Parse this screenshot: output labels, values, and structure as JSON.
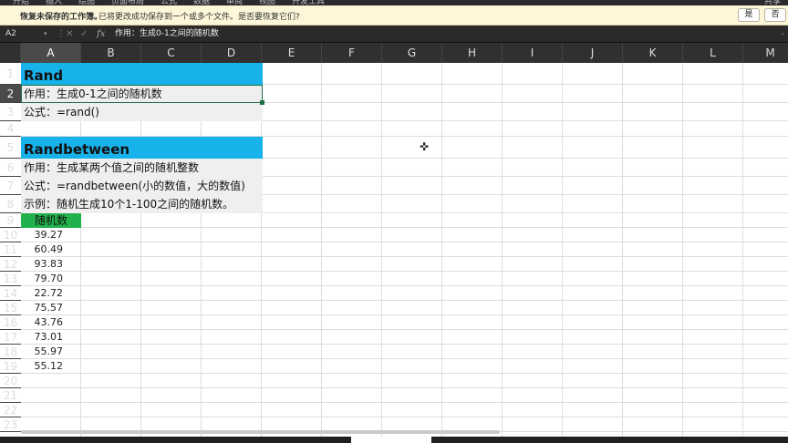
{
  "ribbon": {
    "tabs": [
      "开始",
      "插入",
      "绘图",
      "页面布局",
      "公式",
      "数据",
      "审阅",
      "视图",
      "开发工具"
    ],
    "share_label": "共享"
  },
  "recovery_bar": {
    "title": "恢复未保存的工作簿。",
    "message": "已将更改成功保存到一个或多个文件。是否要恢复它们?",
    "yes_label": "是",
    "no_label": "否"
  },
  "formula_bar": {
    "name_box": "A2",
    "cancel_icon": "close-icon",
    "enter_icon": "check-icon",
    "fx_label": "fx",
    "content": "作用：生成0-1之间的随机数"
  },
  "columns": [
    "A",
    "B",
    "C",
    "D",
    "E",
    "F",
    "G",
    "H",
    "I",
    "J",
    "K",
    "L",
    "M"
  ],
  "selected_column": "A",
  "rows": [
    "1",
    "2",
    "3",
    "4",
    "5",
    "6",
    "7",
    "8",
    "9",
    "10",
    "11",
    "12",
    "13",
    "14",
    "15",
    "16",
    "17",
    "18",
    "19",
    "20",
    "21",
    "22",
    "23"
  ],
  "selected_row": "2",
  "sections": {
    "rand_title": "Rand",
    "rand_purpose": "作用：生成0-1之间的随机数",
    "rand_formula": "公式：=rand()",
    "rb_title": "Randbetween",
    "rb_purpose": "作用：生成某两个值之间的随机整数",
    "rb_formula": "公式：=randbetween(小的数值，大的数值)",
    "rb_example": "示例：随机生成10个1-100之间的随机数。"
  },
  "table": {
    "header": "随机数",
    "values": [
      "39.27",
      "60.49",
      "93.83",
      "79.70",
      "22.72",
      "75.57",
      "43.76",
      "73.01",
      "55.97",
      "55.12"
    ]
  },
  "colors": {
    "section_blue": "#18b2ea",
    "header_green": "#22b14c",
    "selection_green": "#1e7145"
  }
}
